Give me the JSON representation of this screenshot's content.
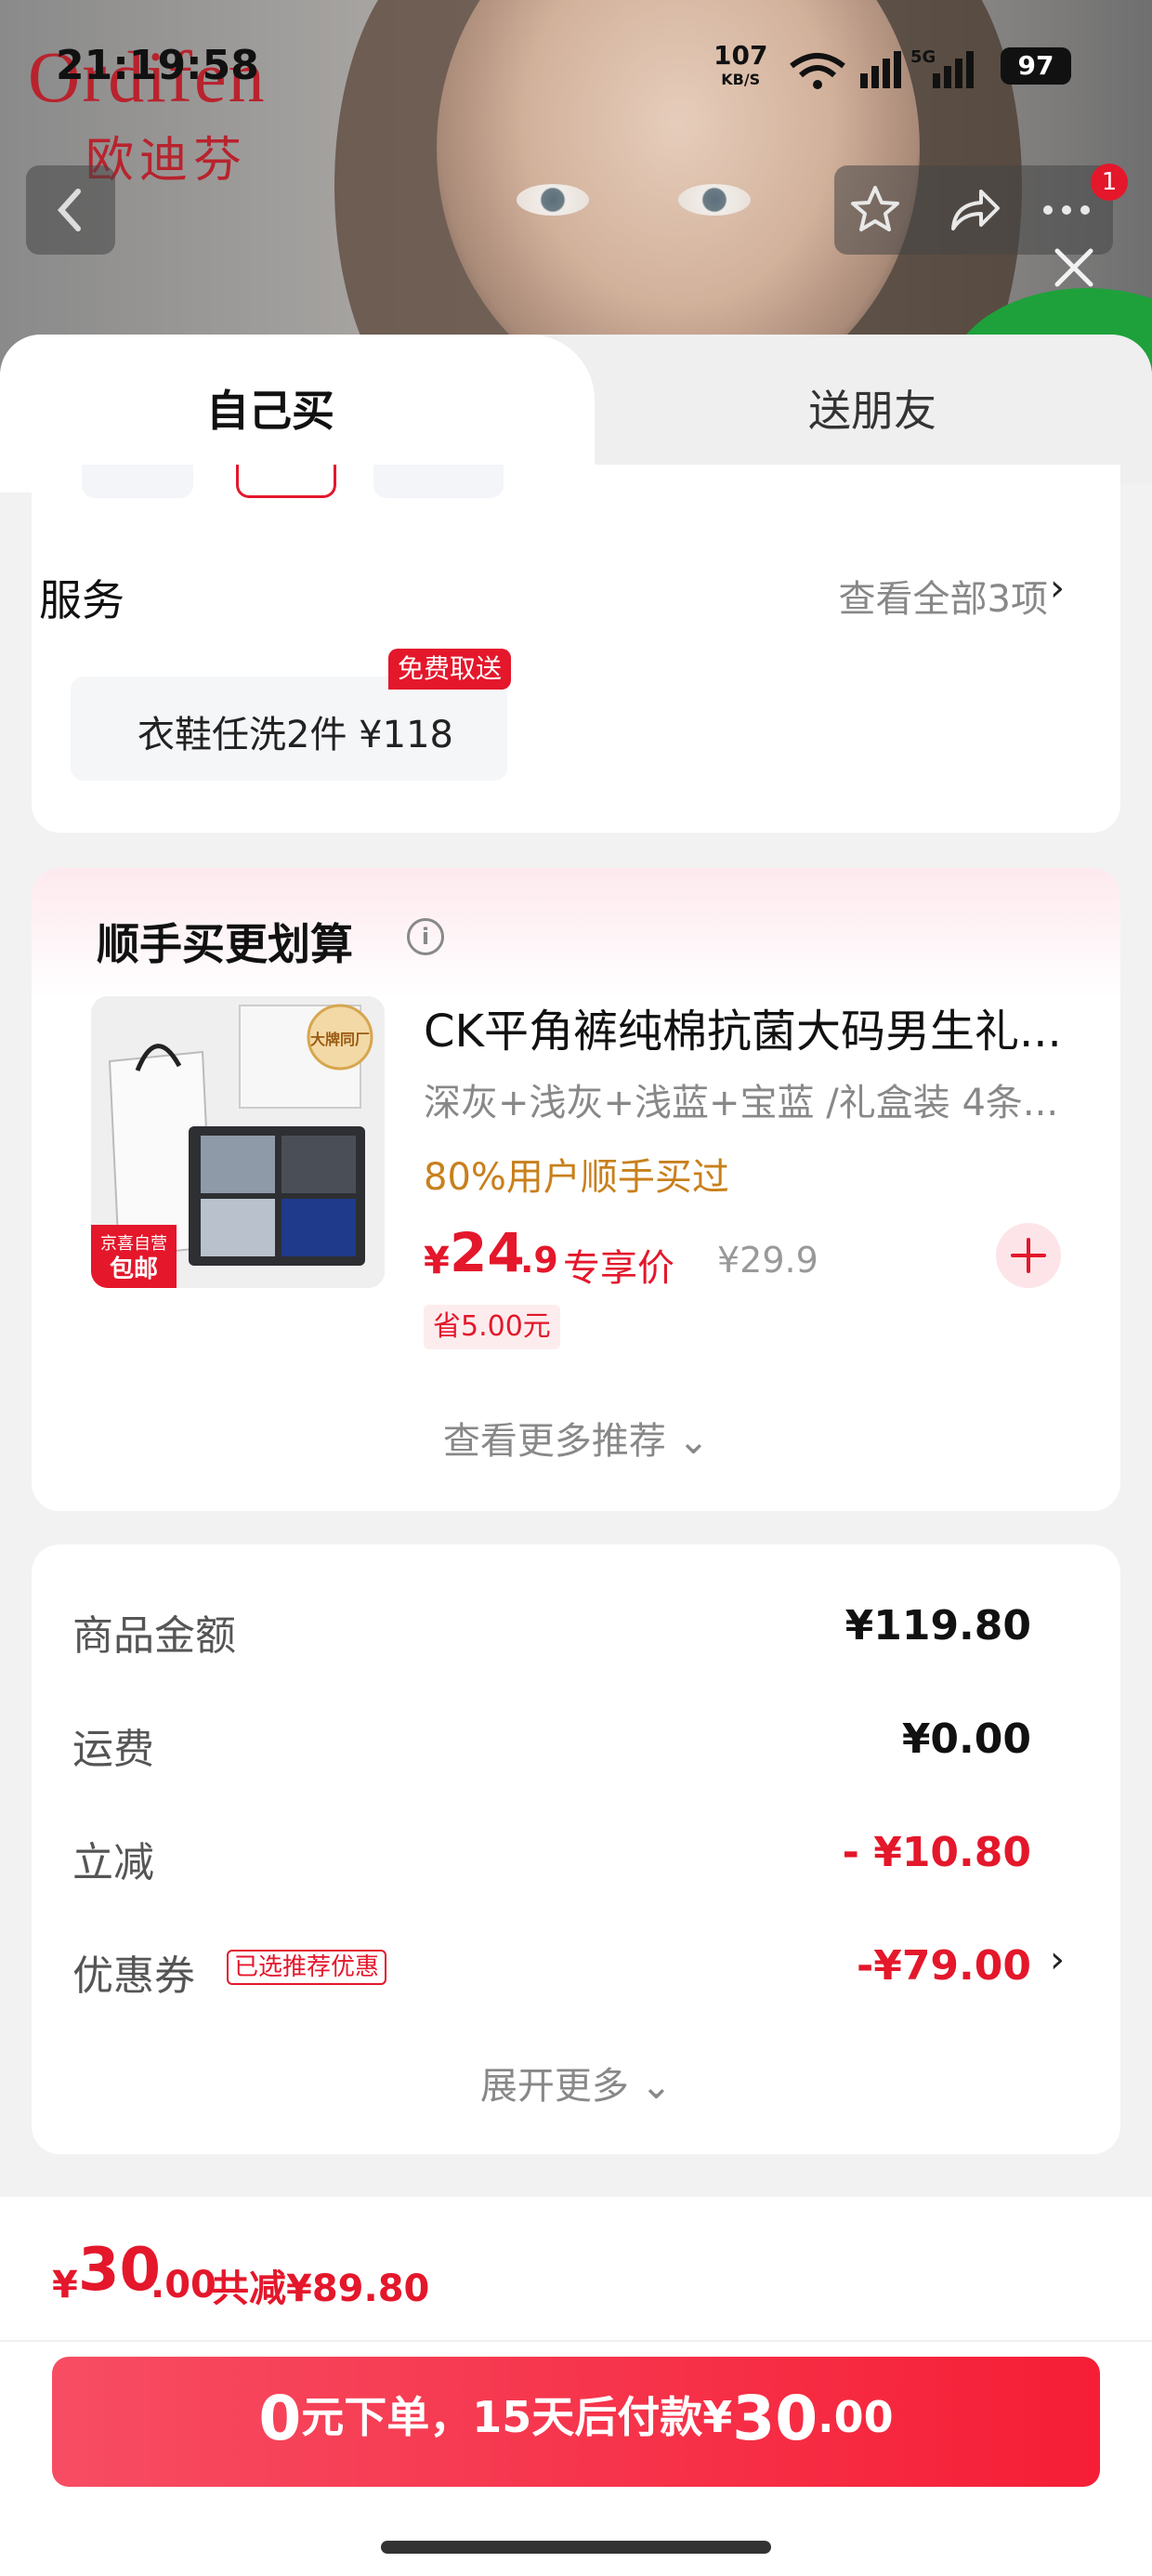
{
  "status_bar": {
    "time": "21:19:58",
    "net_speed": "107",
    "net_unit": "KB/S",
    "network_type": "5G",
    "battery": "97"
  },
  "banner": {
    "brand_en": "Ordifen",
    "brand_cn": "欧迪芬",
    "cart_badge": "1"
  },
  "tabs": {
    "self": "自己买",
    "gift": "送朋友"
  },
  "service": {
    "title": "服务",
    "view_all": "查看全部3项",
    "item_name": "衣鞋任洗2件",
    "item_price": "¥118",
    "item_tag": "免费取送"
  },
  "recommend": {
    "title": "顺手买更划算",
    "product": {
      "title": "CK平角裤纯棉抗菌大码男生礼...",
      "spec": "深灰+浅灰+浅蓝+宝蓝 /礼盒装 4条...",
      "bought": "80%用户顺手买过",
      "price_currency": "¥",
      "price_int": "24",
      "price_dec": ".9",
      "price_label": "专享价",
      "old_price": "¥29.9",
      "save": "省5.00元",
      "img_badge_top": "大牌同厂",
      "img_badge_bottom_1": "京喜自营",
      "img_badge_bottom_2": "包邮"
    },
    "see_more": "查看更多推荐"
  },
  "summary": {
    "rows": [
      {
        "label": "商品金额",
        "value": "¥119.80"
      },
      {
        "label": "运费",
        "value": "¥0.00"
      },
      {
        "label": "立减",
        "value": "- ¥10.80"
      },
      {
        "label": "优惠券",
        "value": "-¥79.00"
      }
    ],
    "coupon_tag": "已选推荐优惠",
    "expand": "展开更多"
  },
  "bottom": {
    "total_currency": "¥",
    "total_int": "30",
    "total_dec": ".00",
    "total_saved": "共减¥89.80",
    "pay_zero": "0",
    "pay_text_1": "元下单，",
    "pay_days": "15",
    "pay_text_2": "天后付款¥",
    "pay_int": "30",
    "pay_dec": ".00"
  },
  "colors": {
    "accent": "#e4172b",
    "orange": "#c8801c",
    "brand": "#b8232d"
  }
}
